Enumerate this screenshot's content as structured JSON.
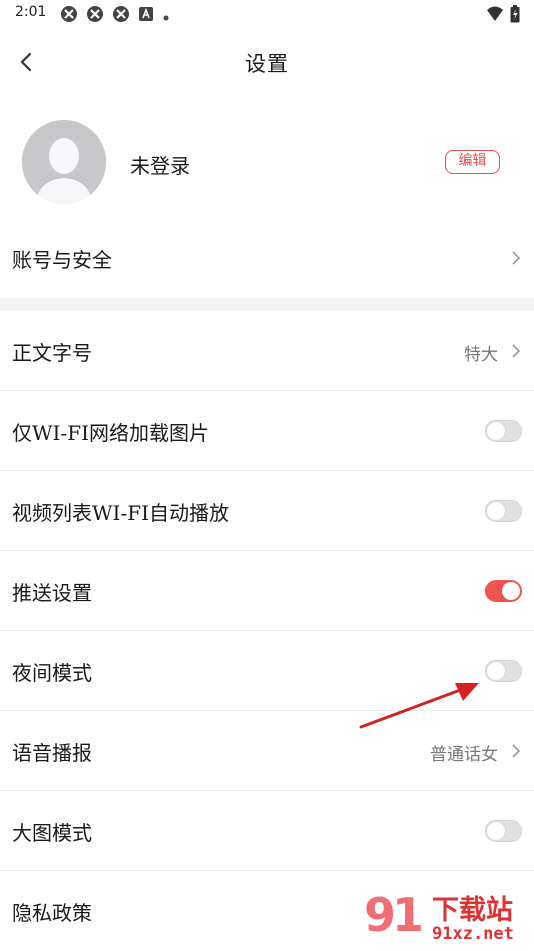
{
  "status_bar": {
    "time": "2:01",
    "left_icons": [
      "app-icon",
      "app-icon",
      "app-icon",
      "a-icon",
      "dot-icon"
    ],
    "right_icons": [
      "wifi-icon",
      "battery-icon"
    ]
  },
  "header": {
    "title": "设置"
  },
  "profile": {
    "name": "未登录",
    "edit_label": "编辑"
  },
  "rows": [
    {
      "label": "账号与安全",
      "value": "",
      "control": "chevron"
    },
    {
      "label": "正文字号",
      "value": "特大",
      "control": "chevron"
    },
    {
      "label": "仅WI-FI网络加载图片",
      "value": "",
      "control": "toggle",
      "on": false
    },
    {
      "label": "视频列表WI-FI自动播放",
      "value": "",
      "control": "toggle",
      "on": false
    },
    {
      "label": "推送设置",
      "value": "",
      "control": "toggle",
      "on": true
    },
    {
      "label": "夜间模式",
      "value": "",
      "control": "toggle",
      "on": false
    },
    {
      "label": "语音播报",
      "value": "普通话女",
      "control": "chevron"
    },
    {
      "label": "大图模式",
      "value": "",
      "control": "toggle",
      "on": false
    },
    {
      "label": "隐私政策",
      "value": "",
      "control": "chevron"
    }
  ],
  "watermark": {
    "number": "91",
    "title": "下载站",
    "url": "91xz.net"
  },
  "colors": {
    "accent": "#ef5350",
    "edit": "#e2514c",
    "annotation_arrow": "#d32020",
    "watermark": "#d33333"
  }
}
